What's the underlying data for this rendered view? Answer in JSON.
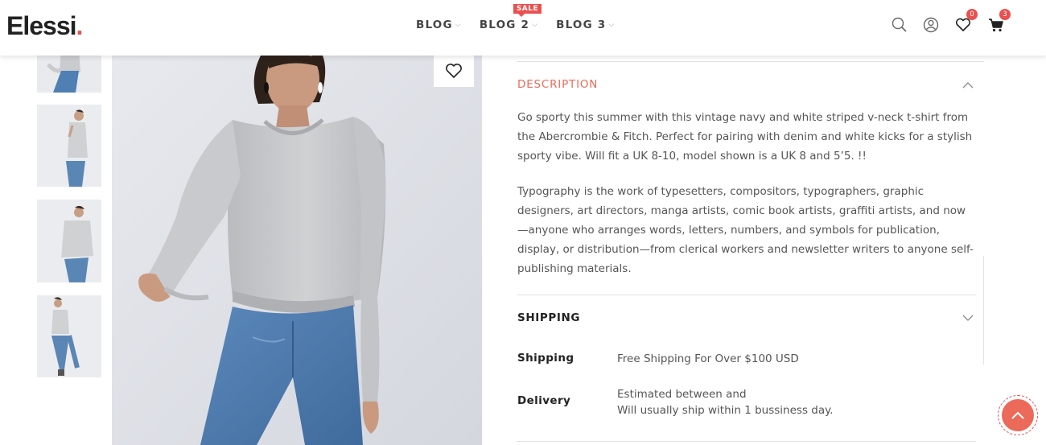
{
  "brand": {
    "name": "Elessi",
    "dot": "."
  },
  "nav": [
    {
      "label": "BLOG",
      "badge": ""
    },
    {
      "label": "BLOG 2",
      "badge": "SALE"
    },
    {
      "label": "BLOG 3",
      "badge": ""
    }
  ],
  "header_icons": {
    "wishlist_count": "0",
    "cart_count": "3"
  },
  "description": {
    "title": "DESCRIPTION",
    "paragraph1": "Go sporty this summer with this vintage navy and white striped v-neck t-shirt from the Abercrombie & Fitch. Perfect for pairing with denim and white kicks for a stylish sporty vibe. Will fit a UK 8-10, model shown is a UK 8 and 5’5. !!",
    "paragraph2": "Typography is the work of typesetters, compositors, typographers, graphic designers, art directors, manga artists, comic book artists, graffiti artists, and now—anyone who arranges words, letters, numbers, and symbols for publication, display, or distribution—from clerical workers and newsletter writers to anyone self-publishing materials."
  },
  "shipping": {
    "title": "SHIPPING",
    "rows": [
      {
        "label": "Shipping",
        "value": "Free Shipping For Over $100 USD",
        "value2": ""
      },
      {
        "label": "Delivery",
        "value": "Estimated between  and",
        "value2": "Will usually ship within 1 bussiness day."
      }
    ]
  },
  "colors": {
    "accent": "#ec4f4f",
    "accent_soft": "#ec6a5a"
  }
}
